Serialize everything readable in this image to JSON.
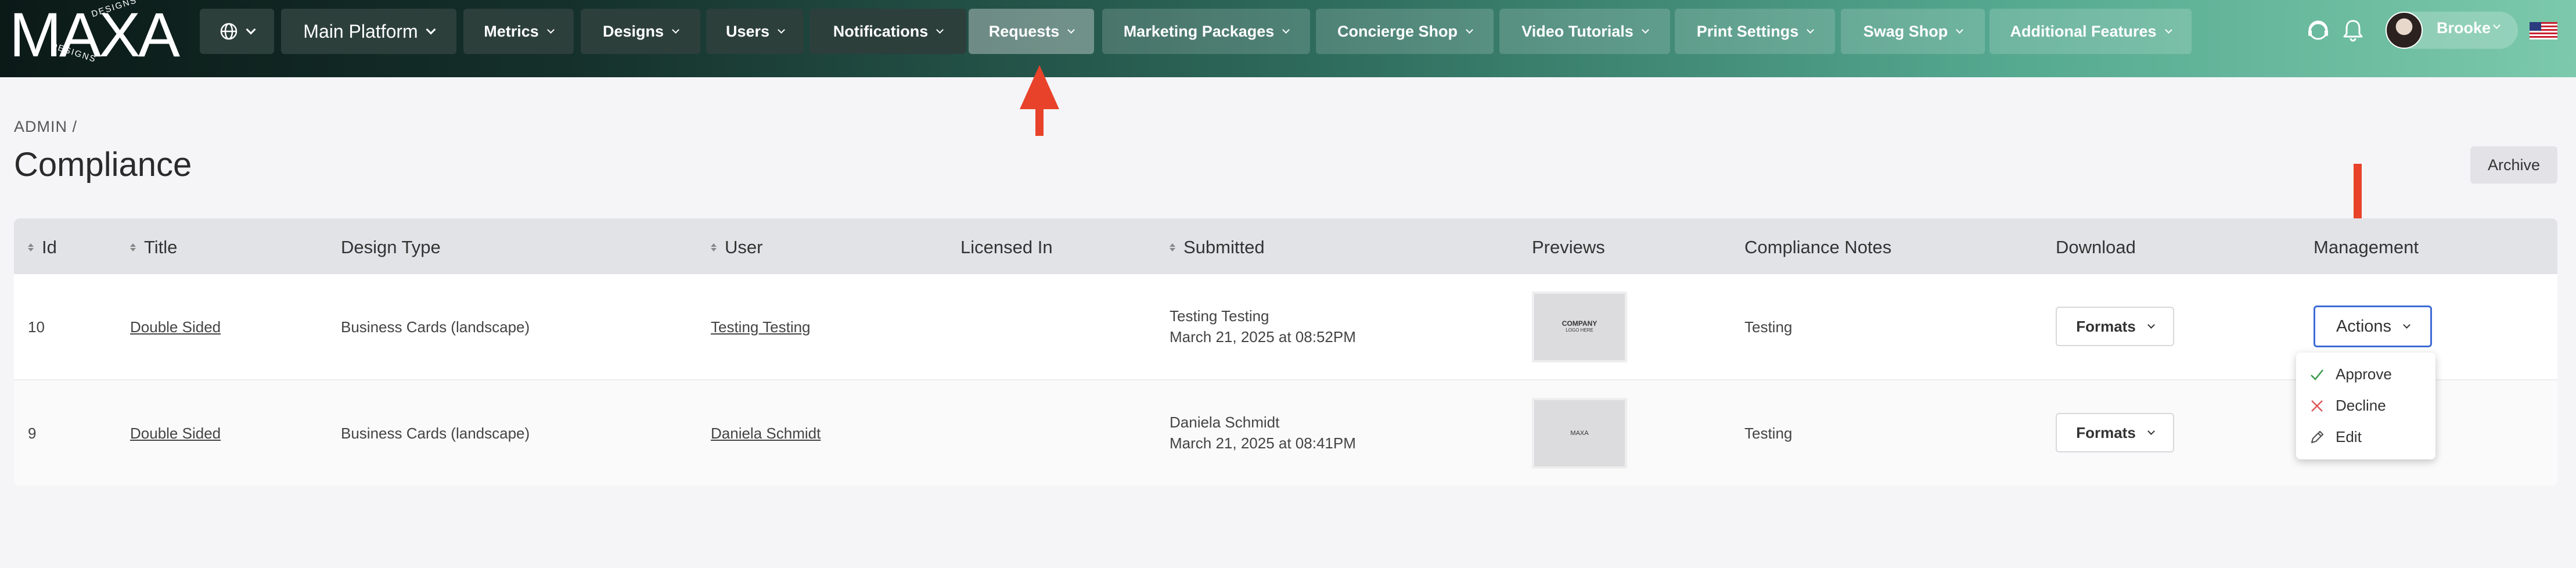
{
  "logo": {
    "text": "MAXA",
    "ring_text": "DESIGNS"
  },
  "nav": {
    "items": [
      {
        "label": "Main Platform"
      },
      {
        "label": "Metrics"
      },
      {
        "label": "Designs"
      },
      {
        "label": "Users"
      },
      {
        "label": "Notifications"
      },
      {
        "label": "Requests"
      },
      {
        "label": "Marketing Packages"
      },
      {
        "label": "Concierge Shop"
      },
      {
        "label": "Video Tutorials"
      },
      {
        "label": "Print Settings"
      },
      {
        "label": "Swag Shop"
      },
      {
        "label": "Additional Features"
      }
    ],
    "user_name": "Brooke"
  },
  "header": {
    "breadcrumb": "ADMIN  /",
    "title": "Compliance",
    "archive_label": "Archive"
  },
  "table": {
    "columns": [
      "Id",
      "Title",
      "Design Type",
      "User",
      "Licensed In",
      "Submitted",
      "Previews",
      "Compliance Notes",
      "Download",
      "Management"
    ],
    "rows": [
      {
        "id": "10",
        "title": "Double Sided",
        "design_type": "Business Cards (landscape)",
        "user": "Testing Testing",
        "licensed_in": "",
        "submitted_by": "Testing Testing",
        "submitted_at": "March 21, 2025 at 08:52PM",
        "preview_line1": "COMPANY",
        "preview_line2": "LOGO HERE",
        "notes": "Testing",
        "download_label": "Formats",
        "management_label": "Actions"
      },
      {
        "id": "9",
        "title": "Double Sided",
        "design_type": "Business Cards (landscape)",
        "user": "Daniela Schmidt",
        "licensed_in": "",
        "submitted_by": "Daniela Schmidt",
        "submitted_at": "March 21, 2025 at 08:41PM",
        "preview_line1": "MAXA",
        "preview_line2": "",
        "notes": "Testing",
        "download_label": "Formats"
      }
    ]
  },
  "actions_menu": {
    "items": [
      {
        "label": "Approve",
        "icon": "check-icon",
        "color": "#3a9a4a"
      },
      {
        "label": "Decline",
        "icon": "x-icon",
        "color": "#e05656"
      },
      {
        "label": "Edit",
        "icon": "pencil-icon",
        "color": "#555555"
      }
    ]
  },
  "colors": {
    "annotation_arrow": "#e8432a",
    "actions_border": "#3d6ad6"
  }
}
